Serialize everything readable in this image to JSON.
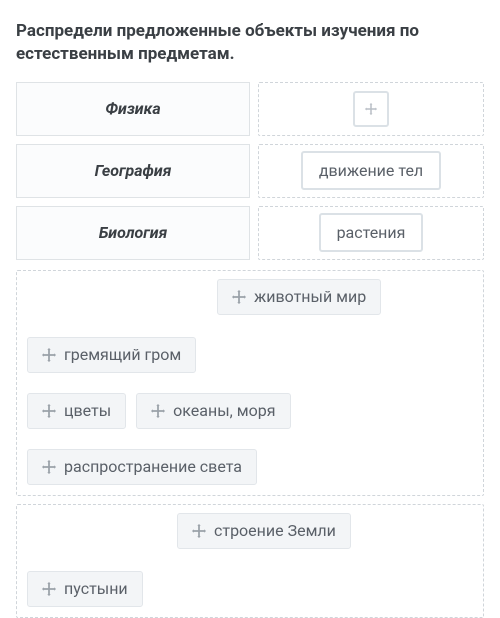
{
  "prompt": "Распредели предложенные объекты изучения по естественным предметам.",
  "categories": [
    {
      "label": "Физика",
      "placed": null
    },
    {
      "label": "География",
      "placed": "движение тел"
    },
    {
      "label": "Биология",
      "placed": "растения"
    }
  ],
  "bank": [
    "животный мир",
    "гремящий гром",
    "цветы",
    "океаны, моря",
    "распространение света",
    "строение Земли",
    "пустыни"
  ],
  "icons": {
    "move": "move-icon"
  }
}
